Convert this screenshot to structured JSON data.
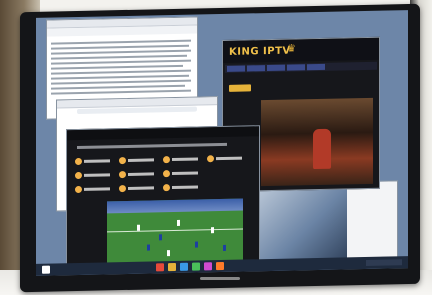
{
  "scene": {
    "colors": {
      "bezel": "#141518",
      "accent": "#e6b33a",
      "pitch": "#3f8a3a"
    }
  },
  "iptv_window": {
    "brand": "KING IPTV"
  },
  "taskbar": {
    "icons": [
      "start-icon",
      "browser-icon",
      "folder-icon",
      "media-icon",
      "app-icon",
      "app-icon-2",
      "app-icon-3"
    ]
  }
}
